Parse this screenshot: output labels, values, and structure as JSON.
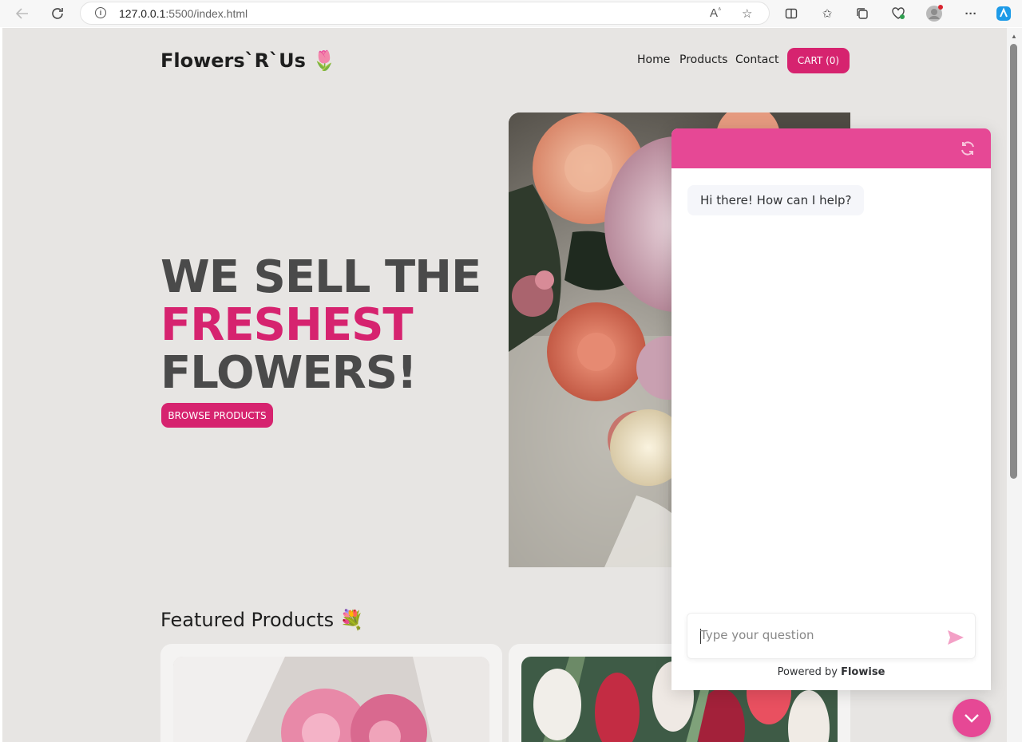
{
  "browser": {
    "url_host": "127.0.0.1",
    "url_rest": ":5500/index.html"
  },
  "site": {
    "brand": "Flowers`R`Us 🌷",
    "nav": {
      "home": "Home",
      "products": "Products",
      "contact": "Contact",
      "cart": "CART (0)"
    },
    "hero": {
      "line1": "WE SELL THE",
      "line2": "FRESHEST",
      "line3": "FLOWERS!",
      "cta": "BROWSE PRODUCTS"
    },
    "featured": {
      "title": "Featured Products 💐"
    }
  },
  "chat": {
    "greeting": "Hi there! How can I help?",
    "input_placeholder": "Type your question",
    "powered_prefix": "Powered by",
    "powered_brand": "Flowise"
  },
  "colors": {
    "accent": "#d6236f",
    "chat_accent": "#e64895",
    "page_bg": "#e7e5e3"
  },
  "icons": {
    "back": "back-arrow-icon",
    "reload": "reload-icon",
    "info": "info-icon",
    "refresh": "refresh-icon",
    "send": "send-icon",
    "collapse": "chevron-down-icon"
  }
}
